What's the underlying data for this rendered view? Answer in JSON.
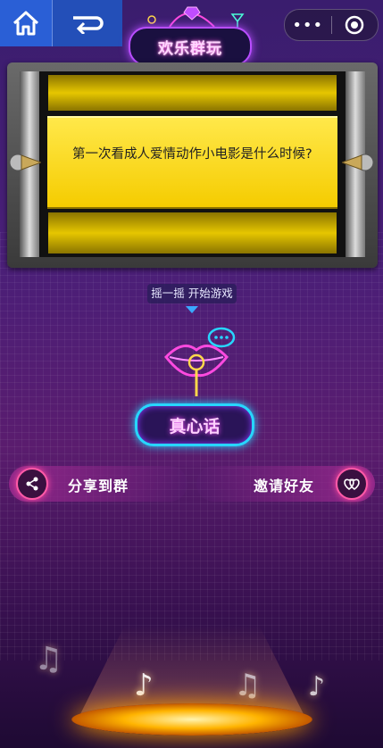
{
  "app": {
    "title": "欢乐群玩"
  },
  "question": {
    "text": "第一次看成人爱情动作小电影是什么时候?"
  },
  "prompt": {
    "shake_text": "摇一摇 开始游戏"
  },
  "game": {
    "mode_label": "真心话"
  },
  "actions": {
    "share_label": "分享到群",
    "invite_label": "邀请好友"
  },
  "capsule": {
    "more_label": "•••"
  },
  "colors": {
    "accent_cyan": "#27d6ff",
    "accent_pink": "#ff4ae0",
    "card_yellow": "#f5cc00"
  },
  "icons": [
    "home-icon",
    "back-icon",
    "more-icon",
    "target-icon",
    "share-icon",
    "invite-icon",
    "lips-mic-icon",
    "music-note-icon"
  ]
}
